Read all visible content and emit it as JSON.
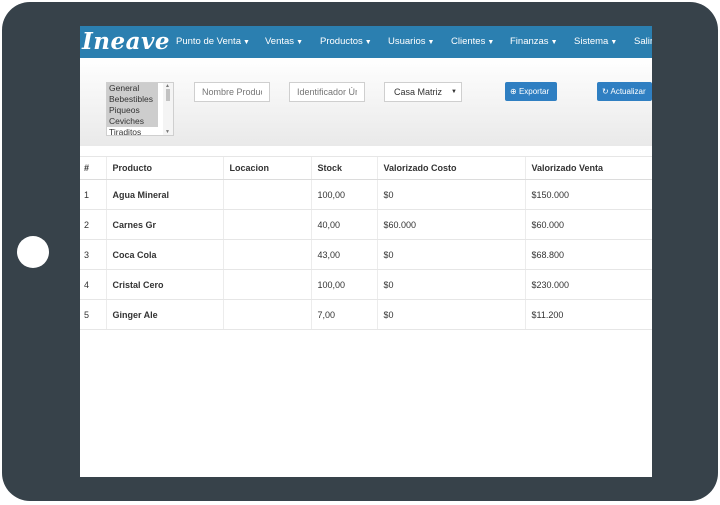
{
  "app": {
    "logo": "Ineave"
  },
  "nav": [
    {
      "label": "Punto de Venta",
      "has_caret": true
    },
    {
      "label": "Ventas",
      "has_caret": true
    },
    {
      "label": "Productos",
      "has_caret": true
    },
    {
      "label": "Usuarios",
      "has_caret": true
    },
    {
      "label": "Clientes",
      "has_caret": true
    },
    {
      "label": "Finanzas",
      "has_caret": true
    },
    {
      "label": "Sistema",
      "has_caret": true
    },
    {
      "label": "Salir",
      "has_caret": false
    }
  ],
  "filters": {
    "category_options": [
      "General",
      "Bebestibles",
      "Piqueos",
      "Ceviches",
      "Tiraditos"
    ],
    "product_name_placeholder": "Nombre Producto",
    "unique_id_placeholder": "Identificador Único",
    "branch_selected": "Casa Matriz",
    "export_label": "Exportar",
    "refresh_label": "Actualizar"
  },
  "table": {
    "headers": [
      "#",
      "Producto",
      "Locacion",
      "Stock",
      "Valorizado Costo",
      "Valorizado Venta"
    ],
    "rows": [
      [
        "1",
        "Agua Mineral",
        "",
        "100,00",
        "$0",
        "$150.000"
      ],
      [
        "2",
        "Carnes Gr",
        "",
        "40,00",
        "$60.000",
        "$60.000"
      ],
      [
        "3",
        "Coca Cola",
        "",
        "43,00",
        "$0",
        "$68.800"
      ],
      [
        "4",
        "Cristal Cero",
        "",
        "100,00",
        "$0",
        "$230.000"
      ],
      [
        "5",
        "Ginger Ale",
        "",
        "7,00",
        "$0",
        "$11.200"
      ]
    ]
  }
}
